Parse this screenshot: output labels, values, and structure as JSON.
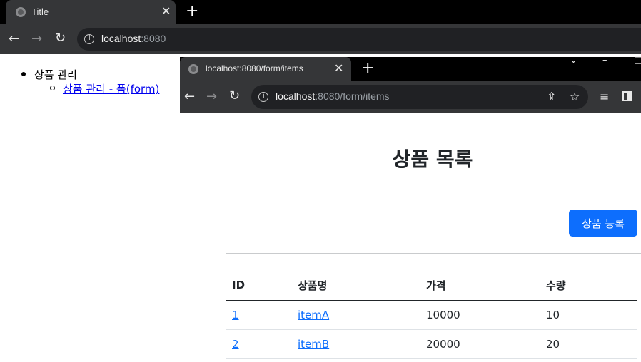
{
  "back_window": {
    "tab_title": "Title",
    "close_glyph": "✕",
    "new_tab_glyph": "+",
    "url_host": "localhost",
    "url_rest": ":8080",
    "nav": {
      "item_label": "상품 관리",
      "sub_link": "상품 관리 - 폼(form)"
    }
  },
  "front_window": {
    "tab_title": "localhost:8080/form/items",
    "close_glyph": "✕",
    "new_tab_glyph": "+",
    "url_host": "localhost",
    "url_rest": ":8080/form/items",
    "page_title": "상품 목록",
    "register_button": "상품 등록",
    "table": {
      "headers": [
        "ID",
        "상품명",
        "가격",
        "수량"
      ],
      "rows": [
        [
          "1",
          "itemA",
          "10000",
          "10"
        ],
        [
          "2",
          "itemB",
          "20000",
          "20"
        ]
      ]
    }
  },
  "icons": {
    "back": "←",
    "forward": "→",
    "reload": "↻",
    "info": "i",
    "share": "⇪",
    "star": "☆",
    "media": "≡",
    "chevron": "⌄",
    "minimize": "–",
    "maximize": "□"
  },
  "colors": {
    "accent": "#0d6efd",
    "tabstrip": "#000000",
    "toolbar": "#353638",
    "omnibox": "#202124"
  }
}
